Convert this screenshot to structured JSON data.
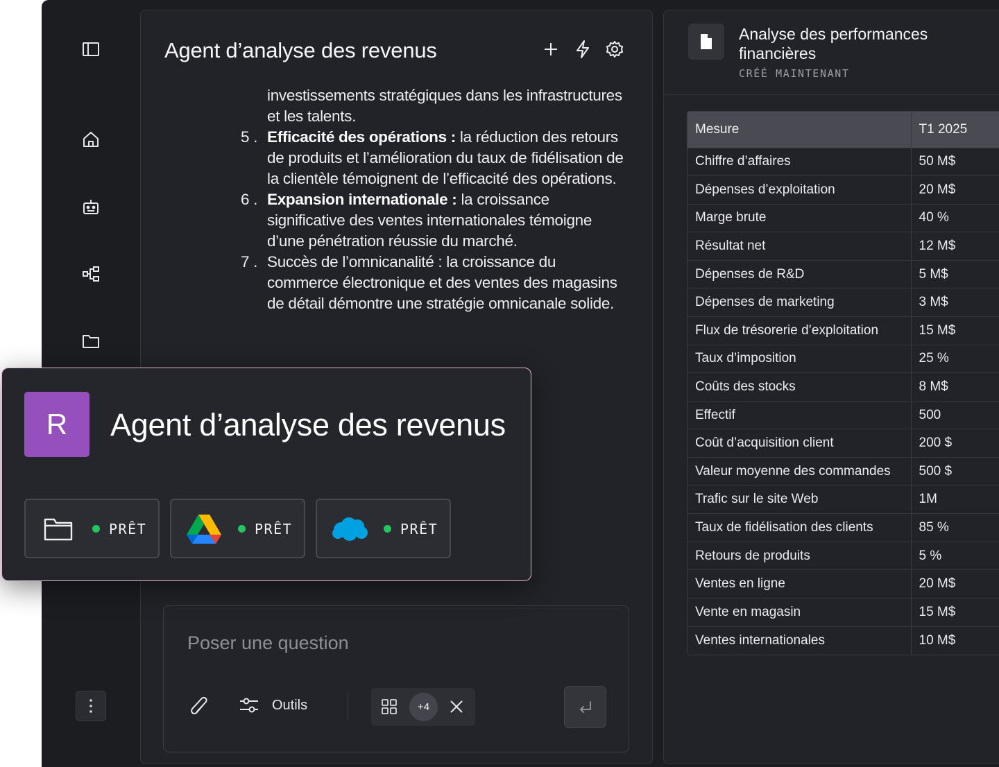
{
  "sidebar": {
    "icons": [
      "panel-toggle-icon",
      "home-icon",
      "bot-icon",
      "workflow-icon",
      "folder-icon",
      "more-vertical-icon"
    ]
  },
  "chat": {
    "title": "Agent d’analyse des revenus",
    "actions": [
      "plus-icon",
      "bolt-icon",
      "gear-icon"
    ],
    "intro": "investissements stratégiques dans les infrastructures et les talents.",
    "items": [
      {
        "num": "5 .",
        "bold": "Efficacité des opérations :",
        "text": " la réduction des retours de produits et l’amélioration du taux de fidélisation de la clientèle témoignent de l’efficacité des opérations."
      },
      {
        "num": "6 .",
        "bold": "Expansion internationale :",
        "text": " la croissance significative des ventes internationales témoigne d’une pénétration réussie du marché."
      },
      {
        "num": "7 .",
        "bold": "",
        "text": " Succès de l’omnicanalité : la croissance du commerce électronique et des ventes des magasins de détail démontre une stratégie omnicanale solide."
      }
    ]
  },
  "agent_card": {
    "avatar_letter": "R",
    "avatar_color": "#9650bd",
    "name": "Agent d’analyse des revenus",
    "tools": [
      {
        "icon": "folder-icon",
        "status": "PRÊT"
      },
      {
        "icon": "google-drive-icon",
        "status": "PRÊT"
      },
      {
        "icon": "salesforce-cloud-icon",
        "status": "PRÊT"
      }
    ],
    "status_color": "#22c55e"
  },
  "composer": {
    "placeholder": "Poser une question",
    "tools_label": "Outils",
    "apps_badge": "+4"
  },
  "document": {
    "title": "Analyse des performances financières",
    "subtitle": "CRÉÉ MAINTENANT",
    "columns": [
      "Mesure",
      "T1 2025"
    ],
    "rows": [
      [
        "Chiffre d’affaires",
        "50 M$"
      ],
      [
        "Dépenses d’exploitation",
        "20 M$"
      ],
      [
        "Marge brute",
        "40 %"
      ],
      [
        "Résultat net",
        "12 M$"
      ],
      [
        "Dépenses de R&D",
        "5 M$"
      ],
      [
        "Dépenses de marketing",
        "3 M$"
      ],
      [
        "Flux de trésorerie d’exploitation",
        "15 M$"
      ],
      [
        "Taux d’imposition",
        "25 %"
      ],
      [
        "Coûts des stocks",
        "8 M$"
      ],
      [
        "Effectif",
        "500"
      ],
      [
        "Coût d’acquisition client",
        "200 $"
      ],
      [
        "Valeur moyenne des commandes",
        "500 $"
      ],
      [
        "Trafic sur le site Web",
        "1M"
      ],
      [
        "Taux de fidélisation des clients",
        "85 %"
      ],
      [
        "Retours de produits",
        "5 %"
      ],
      [
        "Ventes en ligne",
        "20 M$"
      ],
      [
        "Vente en magasin",
        "15 M$"
      ],
      [
        "Ventes internationales",
        "10 M$"
      ]
    ]
  }
}
